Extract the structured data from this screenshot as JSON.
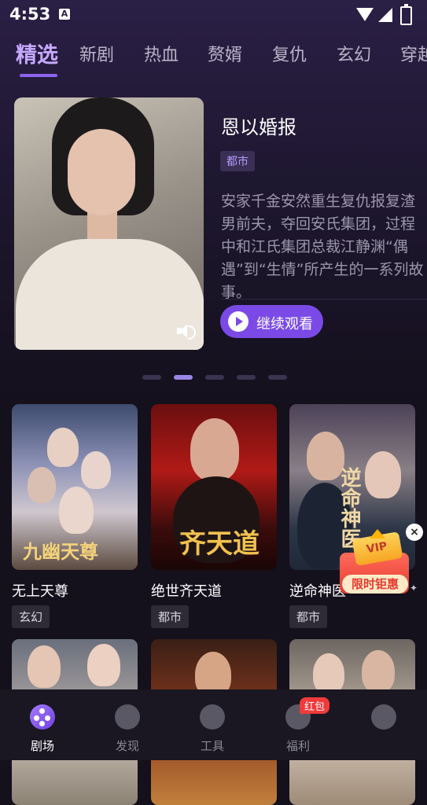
{
  "status_bar": {
    "time": "4:53",
    "notification_icon": "A"
  },
  "tabs": [
    "精选",
    "新剧",
    "热血",
    "赘婿",
    "复仇",
    "玄幻",
    "穿越"
  ],
  "hero": {
    "title": "恩以婚报",
    "tag": "都市",
    "description": "安家千金安然重生复仇报复渣男前夫，夺回安氏集团，过程中和江氏集团总裁江静渊“偶遇”到“生情”所产生的一系列故事。",
    "button_label": "继续观看",
    "carousel": {
      "count": 5,
      "active_index": 1
    }
  },
  "dramas": [
    {
      "title": "无上天尊",
      "tag": "玄幻",
      "poster_text": "九幽天尊"
    },
    {
      "title": "绝世齐天道",
      "tag": "都市",
      "poster_text": "齐天道"
    },
    {
      "title": "逆命神医",
      "tag": "都市",
      "poster_text": "逆命神医"
    },
    {
      "title": "",
      "tag": ""
    },
    {
      "title": "",
      "tag": ""
    },
    {
      "title": "",
      "tag": ""
    }
  ],
  "promo": {
    "badge": "VIP",
    "label": "限时钜惠",
    "close": "×"
  },
  "bottom_nav": [
    {
      "label": "剧场",
      "active": true,
      "icon": "film-reel-icon"
    },
    {
      "label": "发现",
      "active": false,
      "icon": "planet-icon"
    },
    {
      "label": "工具",
      "active": false,
      "icon": "aperture-icon"
    },
    {
      "label": "福利",
      "active": false,
      "icon": "gift-star-icon",
      "badge": "红包"
    },
    {
      "label": "",
      "active": false,
      "icon": "chat-face-icon"
    }
  ],
  "colors": {
    "accent": "#7b4ae6",
    "active_tab": "#c7a9ff",
    "background": "#14101c"
  }
}
